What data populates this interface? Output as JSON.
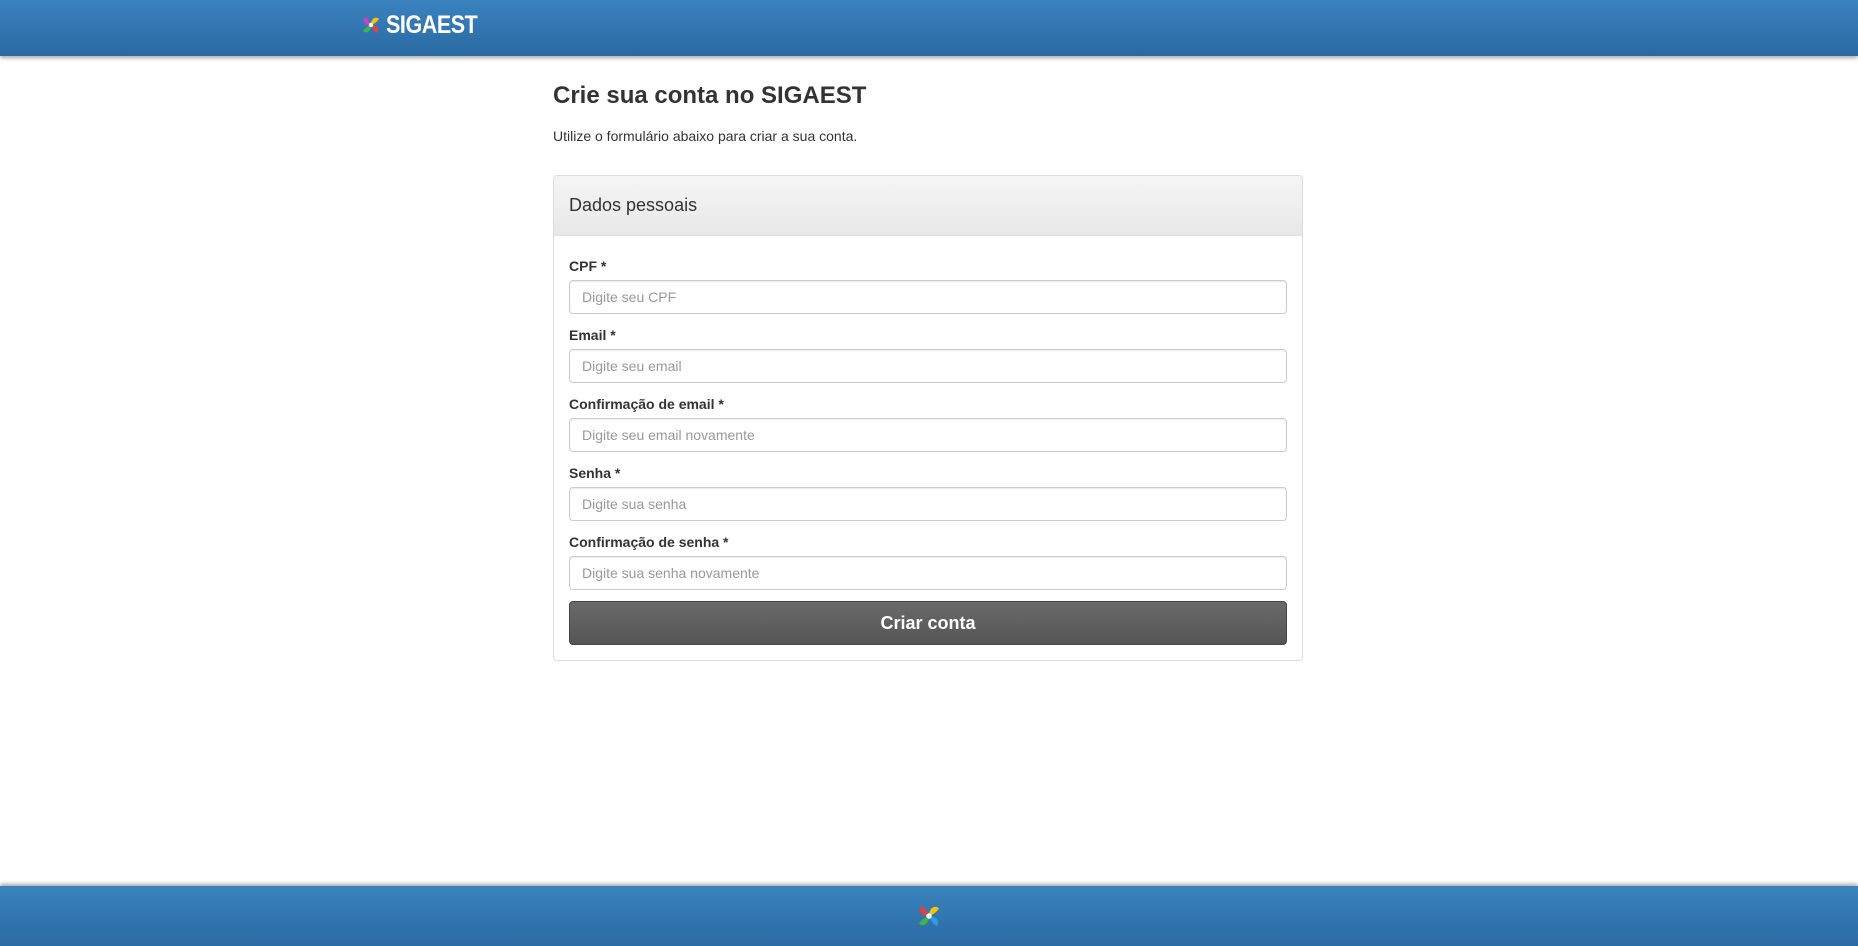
{
  "header": {
    "brand_name": "SIGAEST",
    "logo_icon": "sigaest-pinwheel-logo-icon",
    "background_color": "#2f75b0"
  },
  "main": {
    "title": "Crie sua conta no SIGAEST",
    "subtitle": "Utilize o formulário abaixo para criar a sua conta."
  },
  "form": {
    "panel_title": "Dados pessoais",
    "fields": [
      {
        "label": "CPF *",
        "placeholder": "Digite seu CPF",
        "value": ""
      },
      {
        "label": "Email *",
        "placeholder": "Digite seu email",
        "value": ""
      },
      {
        "label": "Confirmação de email *",
        "placeholder": "Digite seu email novamente",
        "value": ""
      },
      {
        "label": "Senha *",
        "placeholder": "Digite sua senha",
        "value": ""
      },
      {
        "label": "Confirmação de senha *",
        "placeholder": "Digite sua senha novamente",
        "value": ""
      }
    ],
    "submit_label": "Criar conta",
    "submit_color": "#5a5a5a"
  },
  "footer": {
    "logo_icon": "sigaest-pinwheel-logo-icon"
  }
}
